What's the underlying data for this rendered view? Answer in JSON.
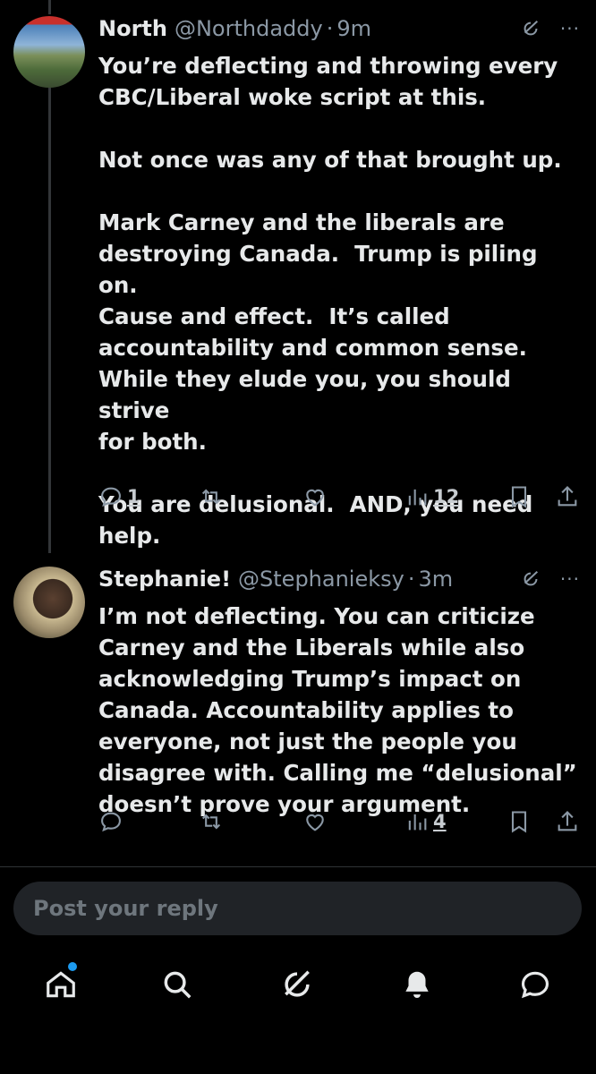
{
  "posts": [
    {
      "name": "North",
      "handle": "@Northdaddy",
      "time": "9m",
      "text": "You’re deflecting and throwing every\nCBC/Liberal woke script at this.\n\nNot once was any of that brought up.\n\nMark Carney and the liberals are\ndestroying Canada.  Trump is piling on.\nCause and effect.  It’s called\naccountability and common sense.\nWhile they elude you, you should strive\nfor both.\n\nYou are delusional.  AND, you need\nhelp.",
      "replies": "1",
      "views": "12"
    },
    {
      "name": "Stephanie!",
      "handle": "@Stephanieksy",
      "time": "3m",
      "text": "I’m not deflecting. You can criticize\nCarney and the Liberals while also\nacknowledging Trump’s impact on\nCanada. Accountability applies to\neveryone, not just the people you\ndisagree with. Calling me “delusional”\ndoesn’t prove your argument.",
      "replies": "",
      "views": "4"
    }
  ],
  "separator": "·",
  "more_label": "···",
  "reply_input": {
    "placeholder": "Post your reply",
    "value": ""
  },
  "tabbar": {
    "items": [
      "home-icon",
      "search-icon",
      "grok-icon",
      "notifications-icon",
      "messages-icon"
    ],
    "home_has_badge": true
  },
  "colors": {
    "background": "#000000",
    "text": "#e7e9ea",
    "muted": "#8b98a5",
    "accent": "#1d9bf0",
    "input_bg": "#202327"
  }
}
